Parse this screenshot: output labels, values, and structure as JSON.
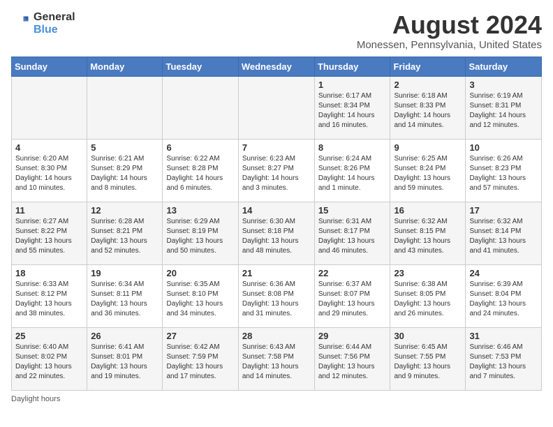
{
  "header": {
    "logo_general": "General",
    "logo_blue": "Blue",
    "month_year": "August 2024",
    "location": "Monessen, Pennsylvania, United States"
  },
  "days_of_week": [
    "Sunday",
    "Monday",
    "Tuesday",
    "Wednesday",
    "Thursday",
    "Friday",
    "Saturday"
  ],
  "footer": {
    "note": "Daylight hours"
  },
  "weeks": [
    [
      {
        "day": "",
        "info": ""
      },
      {
        "day": "",
        "info": ""
      },
      {
        "day": "",
        "info": ""
      },
      {
        "day": "",
        "info": ""
      },
      {
        "day": "1",
        "info": "Sunrise: 6:17 AM\nSunset: 8:34 PM\nDaylight: 14 hours\nand 16 minutes."
      },
      {
        "day": "2",
        "info": "Sunrise: 6:18 AM\nSunset: 8:33 PM\nDaylight: 14 hours\nand 14 minutes."
      },
      {
        "day": "3",
        "info": "Sunrise: 6:19 AM\nSunset: 8:31 PM\nDaylight: 14 hours\nand 12 minutes."
      }
    ],
    [
      {
        "day": "4",
        "info": "Sunrise: 6:20 AM\nSunset: 8:30 PM\nDaylight: 14 hours\nand 10 minutes."
      },
      {
        "day": "5",
        "info": "Sunrise: 6:21 AM\nSunset: 8:29 PM\nDaylight: 14 hours\nand 8 minutes."
      },
      {
        "day": "6",
        "info": "Sunrise: 6:22 AM\nSunset: 8:28 PM\nDaylight: 14 hours\nand 6 minutes."
      },
      {
        "day": "7",
        "info": "Sunrise: 6:23 AM\nSunset: 8:27 PM\nDaylight: 14 hours\nand 3 minutes."
      },
      {
        "day": "8",
        "info": "Sunrise: 6:24 AM\nSunset: 8:26 PM\nDaylight: 14 hours\nand 1 minute."
      },
      {
        "day": "9",
        "info": "Sunrise: 6:25 AM\nSunset: 8:24 PM\nDaylight: 13 hours\nand 59 minutes."
      },
      {
        "day": "10",
        "info": "Sunrise: 6:26 AM\nSunset: 8:23 PM\nDaylight: 13 hours\nand 57 minutes."
      }
    ],
    [
      {
        "day": "11",
        "info": "Sunrise: 6:27 AM\nSunset: 8:22 PM\nDaylight: 13 hours\nand 55 minutes."
      },
      {
        "day": "12",
        "info": "Sunrise: 6:28 AM\nSunset: 8:21 PM\nDaylight: 13 hours\nand 52 minutes."
      },
      {
        "day": "13",
        "info": "Sunrise: 6:29 AM\nSunset: 8:19 PM\nDaylight: 13 hours\nand 50 minutes."
      },
      {
        "day": "14",
        "info": "Sunrise: 6:30 AM\nSunset: 8:18 PM\nDaylight: 13 hours\nand 48 minutes."
      },
      {
        "day": "15",
        "info": "Sunrise: 6:31 AM\nSunset: 8:17 PM\nDaylight: 13 hours\nand 46 minutes."
      },
      {
        "day": "16",
        "info": "Sunrise: 6:32 AM\nSunset: 8:15 PM\nDaylight: 13 hours\nand 43 minutes."
      },
      {
        "day": "17",
        "info": "Sunrise: 6:32 AM\nSunset: 8:14 PM\nDaylight: 13 hours\nand 41 minutes."
      }
    ],
    [
      {
        "day": "18",
        "info": "Sunrise: 6:33 AM\nSunset: 8:12 PM\nDaylight: 13 hours\nand 38 minutes."
      },
      {
        "day": "19",
        "info": "Sunrise: 6:34 AM\nSunset: 8:11 PM\nDaylight: 13 hours\nand 36 minutes."
      },
      {
        "day": "20",
        "info": "Sunrise: 6:35 AM\nSunset: 8:10 PM\nDaylight: 13 hours\nand 34 minutes."
      },
      {
        "day": "21",
        "info": "Sunrise: 6:36 AM\nSunset: 8:08 PM\nDaylight: 13 hours\nand 31 minutes."
      },
      {
        "day": "22",
        "info": "Sunrise: 6:37 AM\nSunset: 8:07 PM\nDaylight: 13 hours\nand 29 minutes."
      },
      {
        "day": "23",
        "info": "Sunrise: 6:38 AM\nSunset: 8:05 PM\nDaylight: 13 hours\nand 26 minutes."
      },
      {
        "day": "24",
        "info": "Sunrise: 6:39 AM\nSunset: 8:04 PM\nDaylight: 13 hours\nand 24 minutes."
      }
    ],
    [
      {
        "day": "25",
        "info": "Sunrise: 6:40 AM\nSunset: 8:02 PM\nDaylight: 13 hours\nand 22 minutes."
      },
      {
        "day": "26",
        "info": "Sunrise: 6:41 AM\nSunset: 8:01 PM\nDaylight: 13 hours\nand 19 minutes."
      },
      {
        "day": "27",
        "info": "Sunrise: 6:42 AM\nSunset: 7:59 PM\nDaylight: 13 hours\nand 17 minutes."
      },
      {
        "day": "28",
        "info": "Sunrise: 6:43 AM\nSunset: 7:58 PM\nDaylight: 13 hours\nand 14 minutes."
      },
      {
        "day": "29",
        "info": "Sunrise: 6:44 AM\nSunset: 7:56 PM\nDaylight: 13 hours\nand 12 minutes."
      },
      {
        "day": "30",
        "info": "Sunrise: 6:45 AM\nSunset: 7:55 PM\nDaylight: 13 hours\nand 9 minutes."
      },
      {
        "day": "31",
        "info": "Sunrise: 6:46 AM\nSunset: 7:53 PM\nDaylight: 13 hours\nand 7 minutes."
      }
    ]
  ]
}
